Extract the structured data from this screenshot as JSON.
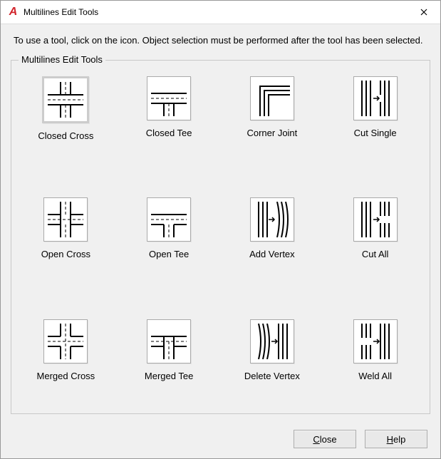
{
  "window": {
    "title": "Multilines Edit Tools"
  },
  "description": "To use a tool, click on the icon.  Object selection must be performed after the tool has been selected.",
  "panel": {
    "legend": "Multilines Edit Tools"
  },
  "tools": {
    "closed_cross": "Closed Cross",
    "closed_tee": "Closed Tee",
    "corner_joint": "Corner Joint",
    "cut_single": "Cut Single",
    "open_cross": "Open Cross",
    "open_tee": "Open Tee",
    "add_vertex": "Add Vertex",
    "cut_all": "Cut All",
    "merged_cross": "Merged Cross",
    "merged_tee": "Merged Tee",
    "delete_vertex": "Delete Vertex",
    "weld_all": "Weld All"
  },
  "buttons": {
    "close": "Close",
    "help": "Help"
  }
}
